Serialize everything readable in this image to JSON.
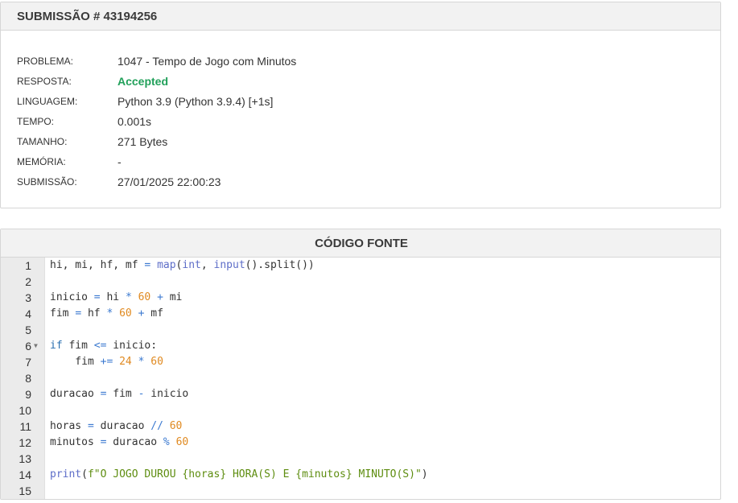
{
  "submission": {
    "title": "SUBMISSÃO # 43194256",
    "rows": [
      {
        "label": "PROBLEMA:",
        "value": "1047 - Tempo de Jogo com Minutos"
      },
      {
        "label": "RESPOSTA:",
        "value": "Accepted",
        "status": "accepted"
      },
      {
        "label": "LINGUAGEM:",
        "value": "Python 3.9 (Python 3.9.4) [+1s]"
      },
      {
        "label": "TEMPO:",
        "value": "0.001s"
      },
      {
        "label": "TAMANHO:",
        "value": "271 Bytes"
      },
      {
        "label": "MEMÓRIA:",
        "value": "-"
      },
      {
        "label": "SUBMISSÃO:",
        "value": "27/01/2025 22:00:23"
      }
    ]
  },
  "source": {
    "title": "CÓDIGO FONTE",
    "lines": [
      {
        "n": "1",
        "tokens": [
          [
            "id",
            "hi, mi, hf, mf "
          ],
          [
            "op",
            "="
          ],
          [
            "id",
            " "
          ],
          [
            "fn",
            "map"
          ],
          [
            "id",
            "("
          ],
          [
            "fn",
            "int"
          ],
          [
            "id",
            ", "
          ],
          [
            "fn",
            "input"
          ],
          [
            "id",
            "().split())"
          ]
        ]
      },
      {
        "n": "2",
        "tokens": []
      },
      {
        "n": "3",
        "tokens": [
          [
            "id",
            "inicio "
          ],
          [
            "op",
            "="
          ],
          [
            "id",
            " hi "
          ],
          [
            "op",
            "*"
          ],
          [
            "id",
            " "
          ],
          [
            "num",
            "60"
          ],
          [
            "id",
            " "
          ],
          [
            "op",
            "+"
          ],
          [
            "id",
            " mi"
          ]
        ]
      },
      {
        "n": "4",
        "tokens": [
          [
            "id",
            "fim "
          ],
          [
            "op",
            "="
          ],
          [
            "id",
            " hf "
          ],
          [
            "op",
            "*"
          ],
          [
            "id",
            " "
          ],
          [
            "num",
            "60"
          ],
          [
            "id",
            " "
          ],
          [
            "op",
            "+"
          ],
          [
            "id",
            " mf"
          ]
        ]
      },
      {
        "n": "5",
        "tokens": []
      },
      {
        "n": "6",
        "fold": true,
        "tokens": [
          [
            "kw",
            "if"
          ],
          [
            "id",
            " fim "
          ],
          [
            "op",
            "<="
          ],
          [
            "id",
            " inicio:"
          ]
        ]
      },
      {
        "n": "7",
        "tokens": [
          [
            "id",
            "    fim "
          ],
          [
            "op",
            "+="
          ],
          [
            "id",
            " "
          ],
          [
            "num",
            "24"
          ],
          [
            "id",
            " "
          ],
          [
            "op",
            "*"
          ],
          [
            "id",
            " "
          ],
          [
            "num",
            "60"
          ]
        ]
      },
      {
        "n": "8",
        "tokens": []
      },
      {
        "n": "9",
        "tokens": [
          [
            "id",
            "duracao "
          ],
          [
            "op",
            "="
          ],
          [
            "id",
            " fim "
          ],
          [
            "op",
            "-"
          ],
          [
            "id",
            " inicio"
          ]
        ]
      },
      {
        "n": "10",
        "tokens": []
      },
      {
        "n": "11",
        "tokens": [
          [
            "id",
            "horas "
          ],
          [
            "op",
            "="
          ],
          [
            "id",
            " duracao "
          ],
          [
            "op",
            "//"
          ],
          [
            "id",
            " "
          ],
          [
            "num",
            "60"
          ]
        ]
      },
      {
        "n": "12",
        "tokens": [
          [
            "id",
            "minutos "
          ],
          [
            "op",
            "="
          ],
          [
            "id",
            " duracao "
          ],
          [
            "op",
            "%"
          ],
          [
            "id",
            " "
          ],
          [
            "num",
            "60"
          ]
        ]
      },
      {
        "n": "13",
        "tokens": []
      },
      {
        "n": "14",
        "tokens": [
          [
            "fn",
            "print"
          ],
          [
            "id",
            "("
          ],
          [
            "str",
            "f\"O JOGO DUROU {horas} HORA(S) E {minutos} MINUTO(S)\""
          ],
          [
            "id",
            ")"
          ]
        ]
      },
      {
        "n": "15",
        "tokens": []
      }
    ]
  },
  "icons": {
    "fold": "fold-arrow-icon"
  },
  "colors": {
    "accepted": "#21a05a",
    "keyword": "#2a6fb0",
    "number": "#e08a21",
    "string": "#5e8d10"
  }
}
